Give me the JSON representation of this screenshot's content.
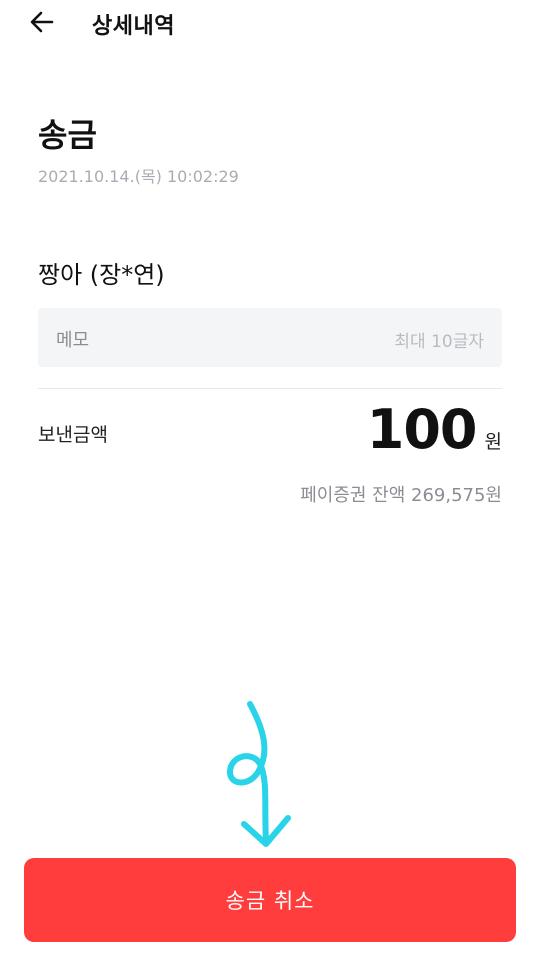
{
  "header": {
    "back_icon": "arrow-left-icon",
    "title": "상세내역"
  },
  "transaction": {
    "type_title": "송금",
    "datetime": "2021.10.14.(목) 10:02:29",
    "recipient": "짱아 (장*연)"
  },
  "memo": {
    "label": "메모",
    "placeholder": "최대 10글자"
  },
  "amount": {
    "label": "보낸금액",
    "value": "100",
    "unit": "원",
    "balance_text": "페이증권 잔액 269,575원"
  },
  "annotation": {
    "icon": "hand-drawn-arrow-down-icon",
    "color": "#29d3e8"
  },
  "footer": {
    "cancel_label": "송금 취소",
    "cancel_color": "#ff3d3d"
  }
}
